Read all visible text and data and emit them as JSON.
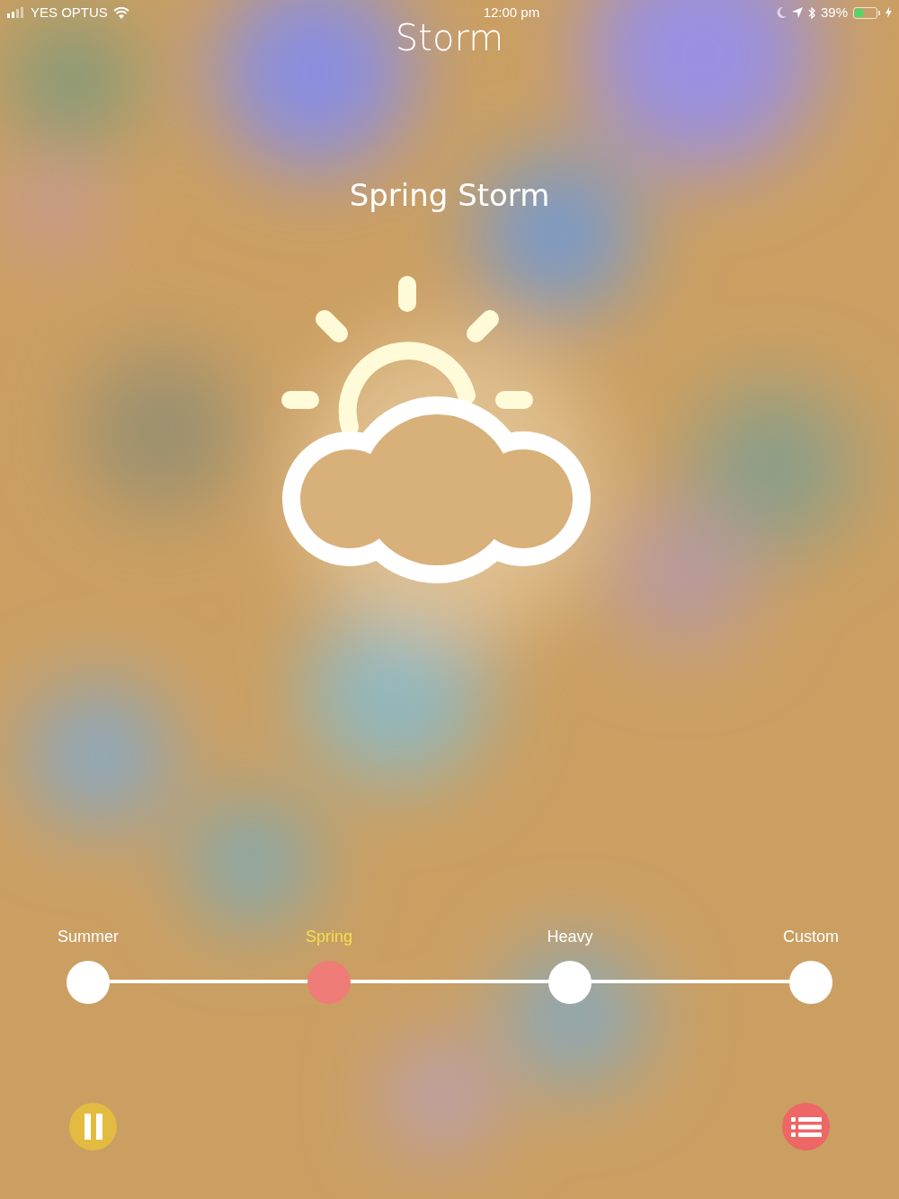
{
  "status_bar": {
    "carrier": "YES OPTUS",
    "time": "12:00 pm",
    "battery": "39%"
  },
  "title": "Storm",
  "preset_name": "Spring Storm",
  "presets": [
    {
      "label": "Summer",
      "selected": false
    },
    {
      "label": "Spring",
      "selected": true
    },
    {
      "label": "Heavy",
      "selected": false
    },
    {
      "label": "Custom",
      "selected": false
    }
  ],
  "playing": true
}
